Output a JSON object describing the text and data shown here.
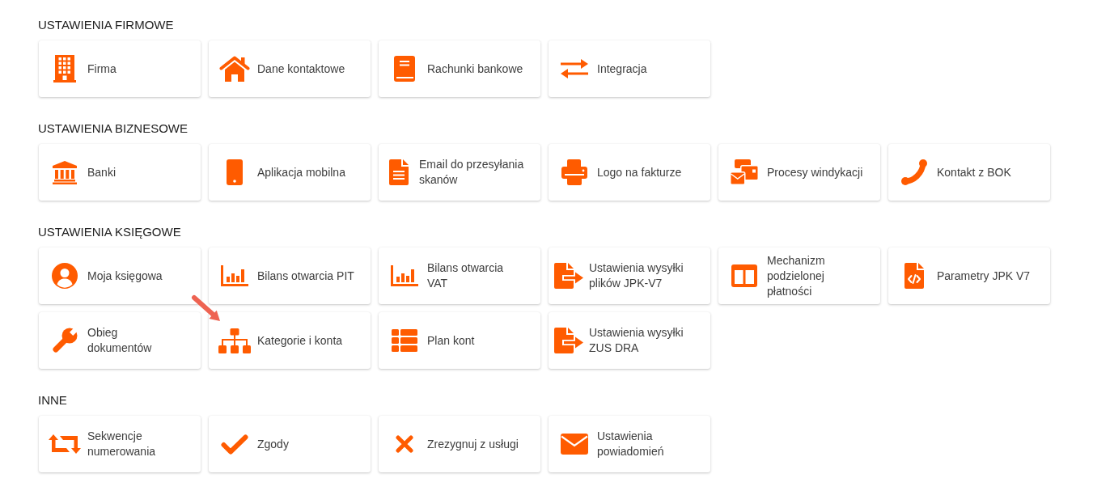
{
  "sections": [
    {
      "title": "USTAWIENIA FIRMOWE",
      "items": [
        {
          "label": "Firma",
          "pointed": false
        },
        {
          "label": "Dane kontaktowe",
          "pointed": false
        },
        {
          "label": "Rachunki bankowe",
          "pointed": false
        },
        {
          "label": "Integracja",
          "pointed": false
        }
      ]
    },
    {
      "title": "USTAWIENIA BIZNESOWE",
      "items": [
        {
          "label": "Banki",
          "pointed": false
        },
        {
          "label": "Aplikacja mobilna",
          "pointed": false
        },
        {
          "label": "Email do przesyłania skanów",
          "pointed": false
        },
        {
          "label": "Logo na fakturze",
          "pointed": false
        },
        {
          "label": "Procesy windykacji",
          "pointed": false
        },
        {
          "label": "Kontakt z BOK",
          "pointed": false
        }
      ]
    },
    {
      "title": "USTAWIENIA KSIĘGOWE",
      "items": [
        {
          "label": "Moja księgowa",
          "pointed": false
        },
        {
          "label": "Bilans otwarcia PIT",
          "pointed": false
        },
        {
          "label": "Bilans otwarcia VAT",
          "pointed": false
        },
        {
          "label": "Ustawienia wysyłki plików JPK-V7",
          "pointed": false
        },
        {
          "label": "Mechanizm podzielonej płatności",
          "pointed": false
        },
        {
          "label": "Parametry JPK V7",
          "pointed": false
        },
        {
          "label": "Obieg dokumentów",
          "pointed": false
        },
        {
          "label": "Kategorie i konta",
          "pointed": true
        },
        {
          "label": "Plan kont",
          "pointed": false
        },
        {
          "label": "Ustawienia wysyłki ZUS DRA",
          "pointed": false
        }
      ]
    },
    {
      "title": "INNE",
      "items": [
        {
          "label": "Sekwencje numerowania",
          "pointed": false
        },
        {
          "label": "Zgody",
          "pointed": false
        },
        {
          "label": "Zrezygnuj z usługi",
          "pointed": false
        },
        {
          "label": "Ustawienia powiadomień",
          "pointed": false
        }
      ]
    }
  ]
}
